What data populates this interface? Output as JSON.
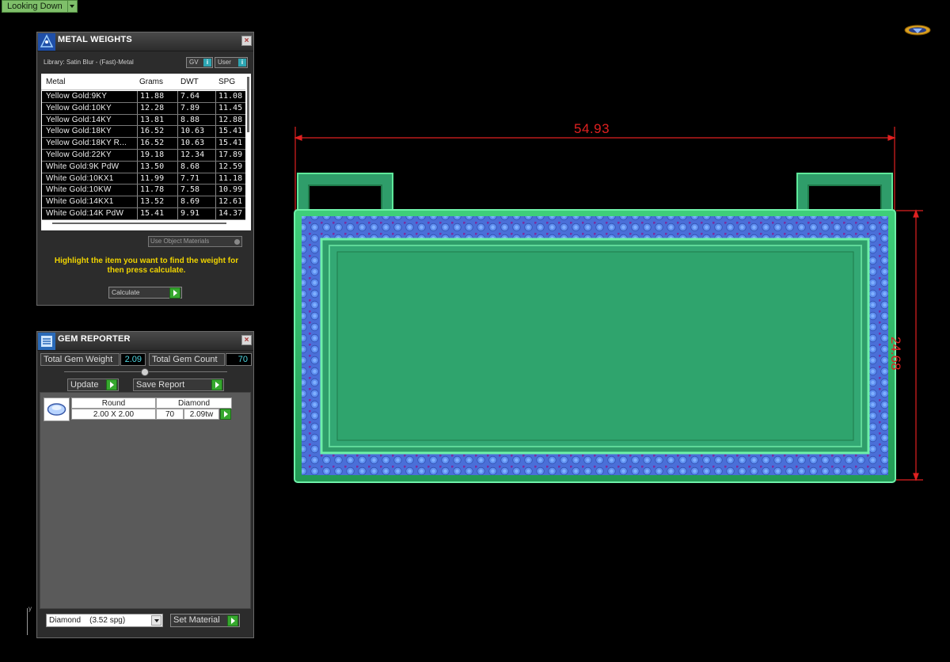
{
  "viewport": {
    "mode_label": "Looking Down",
    "dimension_width": "54.93",
    "dimension_height": "24.68"
  },
  "metal_weights": {
    "title": "METAL WEIGHTS",
    "library": "Library: Satin Blur - (Fast)-Metal",
    "tag_gv": "GV",
    "tag_user": "User",
    "columns": [
      "Metal",
      "Grams",
      "DWT",
      "SPG"
    ],
    "rows": [
      [
        "Yellow Gold:9KY",
        "11.88",
        "7.64",
        "11.08"
      ],
      [
        "Yellow Gold:10KY",
        "12.28",
        "7.89",
        "11.45"
      ],
      [
        "Yellow Gold:14KY",
        "13.81",
        "8.88",
        "12.88"
      ],
      [
        "Yellow Gold:18KY",
        "16.52",
        "10.63",
        "15.41"
      ],
      [
        "Yellow Gold:18KY R...",
        "16.52",
        "10.63",
        "15.41"
      ],
      [
        "Yellow Gold:22KY",
        "19.18",
        "12.34",
        "17.89"
      ],
      [
        "White Gold:9K PdW",
        "13.50",
        "8.68",
        "12.59"
      ],
      [
        "White Gold:10KX1",
        "11.99",
        "7.71",
        "11.18"
      ],
      [
        "White Gold:10KW",
        "11.78",
        "7.58",
        "10.99"
      ],
      [
        "White Gold:14KX1",
        "13.52",
        "8.69",
        "12.61"
      ],
      [
        "White Gold:14K PdW",
        "15.41",
        "9.91",
        "14.37"
      ]
    ],
    "use_object_materials": "Use Object Materials",
    "hint": "Highlight the item you want to find the weight for then press calculate.",
    "calculate_label": "Calculate"
  },
  "gem_reporter": {
    "title": "GEM REPORTER",
    "total_weight_label": "Total Gem Weight",
    "total_weight_value": "2.09",
    "total_count_label": "Total Gem Count",
    "total_count_value": "70",
    "update_label": "Update",
    "save_report_label": "Save Report",
    "gem_row": {
      "shape": "Round",
      "material": "Diamond",
      "size": "2.00 X 2.00",
      "count": "70",
      "weight": "2.09tw"
    },
    "material_select": "Diamond    (3.52 spg)",
    "set_material_label": "Set Material"
  },
  "axis_label": "y",
  "colors": {
    "metal_green": "#2f9d6a",
    "gem_blue": "#4a7fe0",
    "dimension_red": "#e02020",
    "accent_green": "#36a82e"
  }
}
